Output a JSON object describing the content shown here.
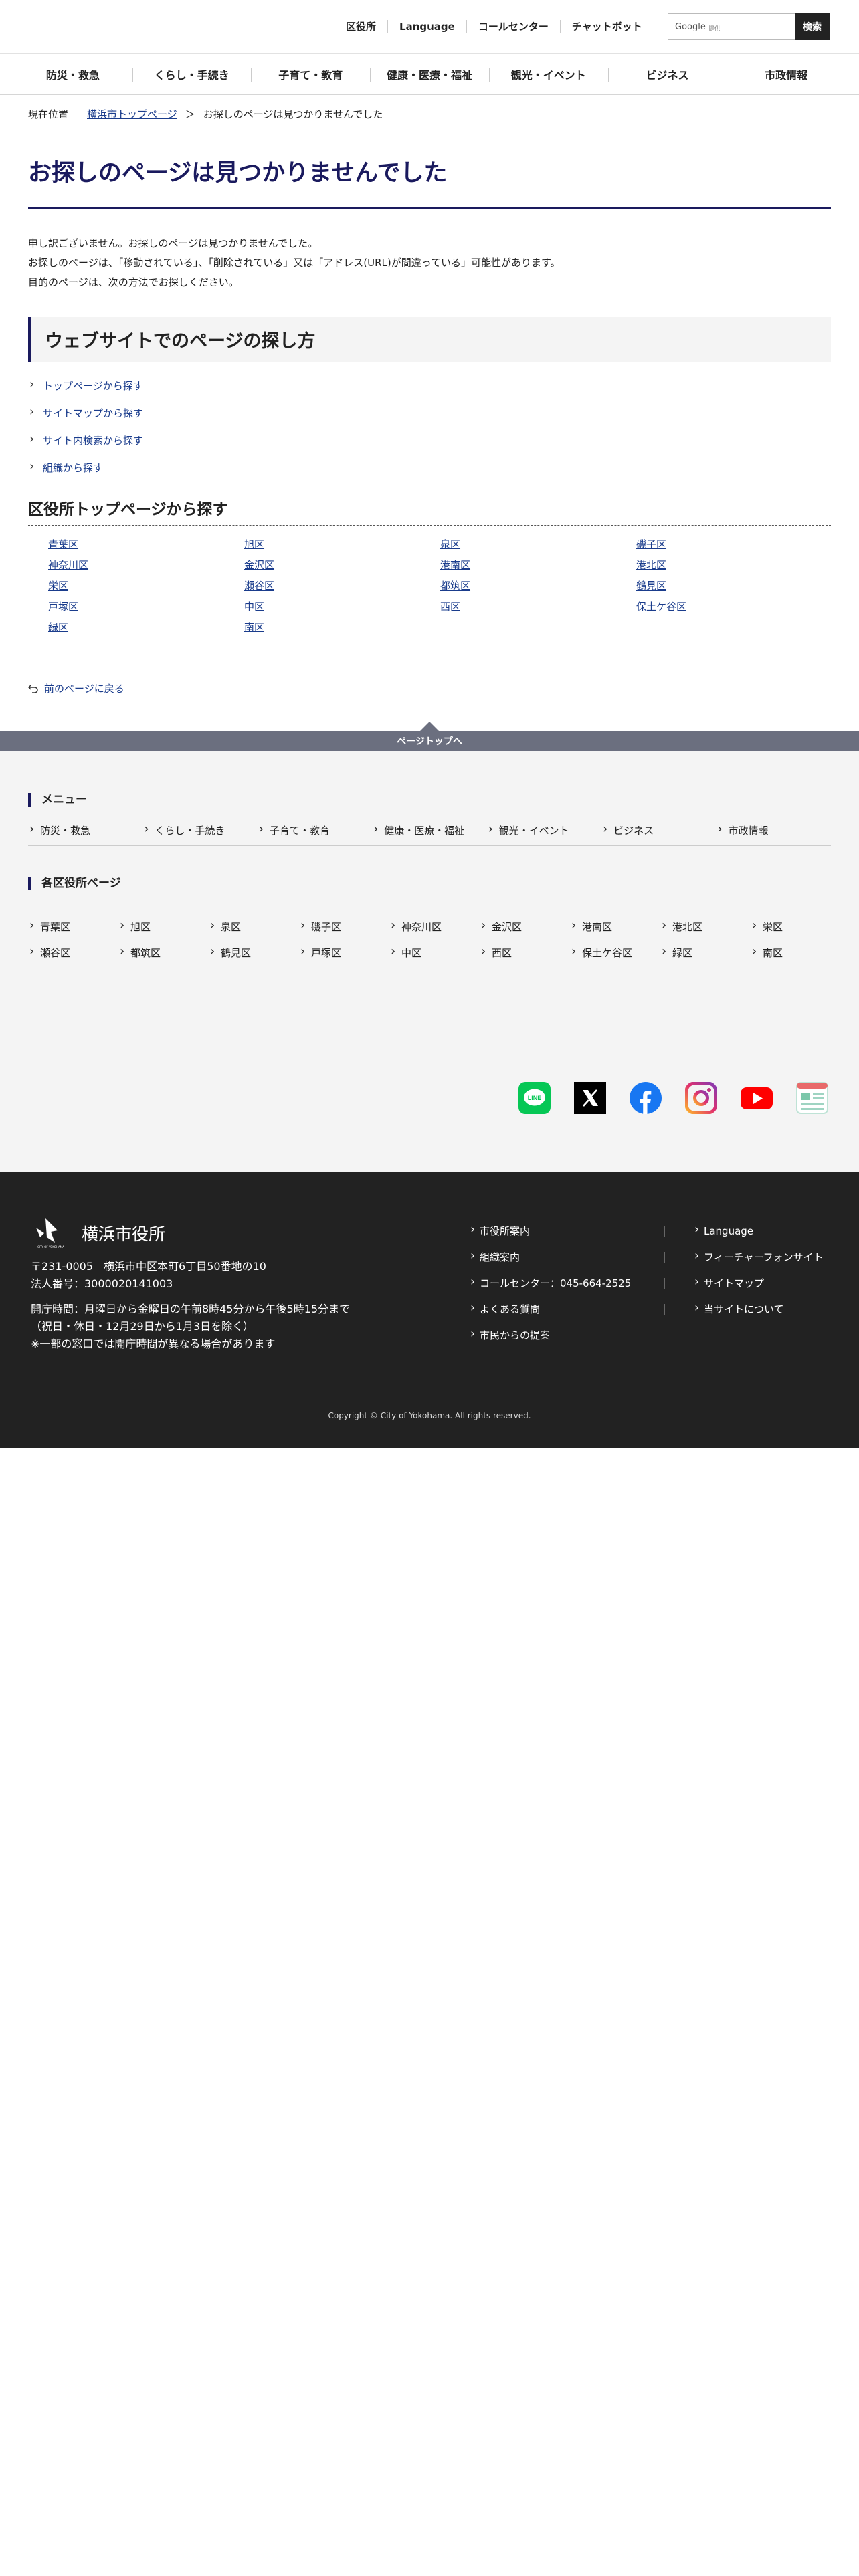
{
  "header": {
    "utility_links": [
      "区役所",
      "Language",
      "コールセンター",
      "チャットボット"
    ],
    "search": {
      "placeholder": "Google 提供",
      "placeholder_main": "Google",
      "placeholder_sub": "提供",
      "button": "検索"
    }
  },
  "nav": [
    "防災・救急",
    "くらし・手続き",
    "子育て・教育",
    "健康・医療・福祉",
    "観光・イベント",
    "ビジネス",
    "市政情報"
  ],
  "breadcrumb": {
    "label": "現在位置",
    "home": "横浜市トップページ",
    "separator": "＞",
    "current": "お探しのページは見つかりませんでした"
  },
  "main": {
    "title": "お探しのページは見つかりませんでした",
    "intro": [
      "申し訳ございません。お探しのページは見つかりませんでした。",
      "お探しのページは、「移動されている」、「削除されている」又は「アドレス(URL)が間違っている」可能性があります。",
      "目的のページは、次の方法でお探しください。"
    ],
    "search_heading": "ウェブサイトでのページの探し方",
    "search_ways": [
      "トップページから探す",
      "サイトマップから探す",
      "サイト内検索から探す",
      "組織から探す"
    ],
    "ward_heading": "区役所トップページから探す",
    "wards": [
      "青葉区",
      "旭区",
      "泉区",
      "磯子区",
      "神奈川区",
      "金沢区",
      "港南区",
      "港北区",
      "栄区",
      "瀬谷区",
      "都筑区",
      "鶴見区",
      "戸塚区",
      "中区",
      "西区",
      "保土ケ谷区",
      "緑区",
      "南区"
    ],
    "back_label": "前のページに戻る"
  },
  "page_top_label": "ページトップへ",
  "lower": {
    "menu_heading": "メニュー",
    "menu_items": [
      "防災・救急",
      "くらし・手続き",
      "子育て・教育",
      "健康・医療・福祉",
      "観光・イベント",
      "ビジネス",
      "市政情報"
    ],
    "wards_heading": "各区役所ページ",
    "wards": [
      "青葉区",
      "旭区",
      "泉区",
      "磯子区",
      "神奈川区",
      "金沢区",
      "港南区",
      "港北区",
      "栄区",
      "瀬谷区",
      "都筑区",
      "鶴見区",
      "戸塚区",
      "中区",
      "西区",
      "保土ケ谷区",
      "緑区",
      "南区"
    ],
    "sns_icons": [
      "line-icon",
      "x-icon",
      "facebook-icon",
      "instagram-icon",
      "youtube-icon",
      "news-icon"
    ],
    "sns_labels": {
      "line": "LINE"
    }
  },
  "footer": {
    "logo_text": "横浜市役所",
    "logo_small": "CITY OF YOKOHAMA",
    "address": "〒231-0005　横浜市中区本町6丁目50番地の10",
    "corporate_number": "法人番号：3000020141003",
    "hours": "開庁時間：月曜日から金曜日の午前8時45分から午後5時15分まで",
    "hours_note": "（祝日・休日・12月29日から1月3日を除く）",
    "hours_note2": "※一部の窓口では開庁時間が異なる場合があります",
    "links_left": [
      "市役所案内",
      "組織案内",
      "コールセンター：045-664-2525",
      "よくある質問",
      "市民からの提案"
    ],
    "links_right": [
      "Language",
      "フィーチャーフォンサイト",
      "サイトマップ",
      "当サイトについて"
    ],
    "copyright": "Copyright © City of Yokohama. All rights reserved."
  }
}
